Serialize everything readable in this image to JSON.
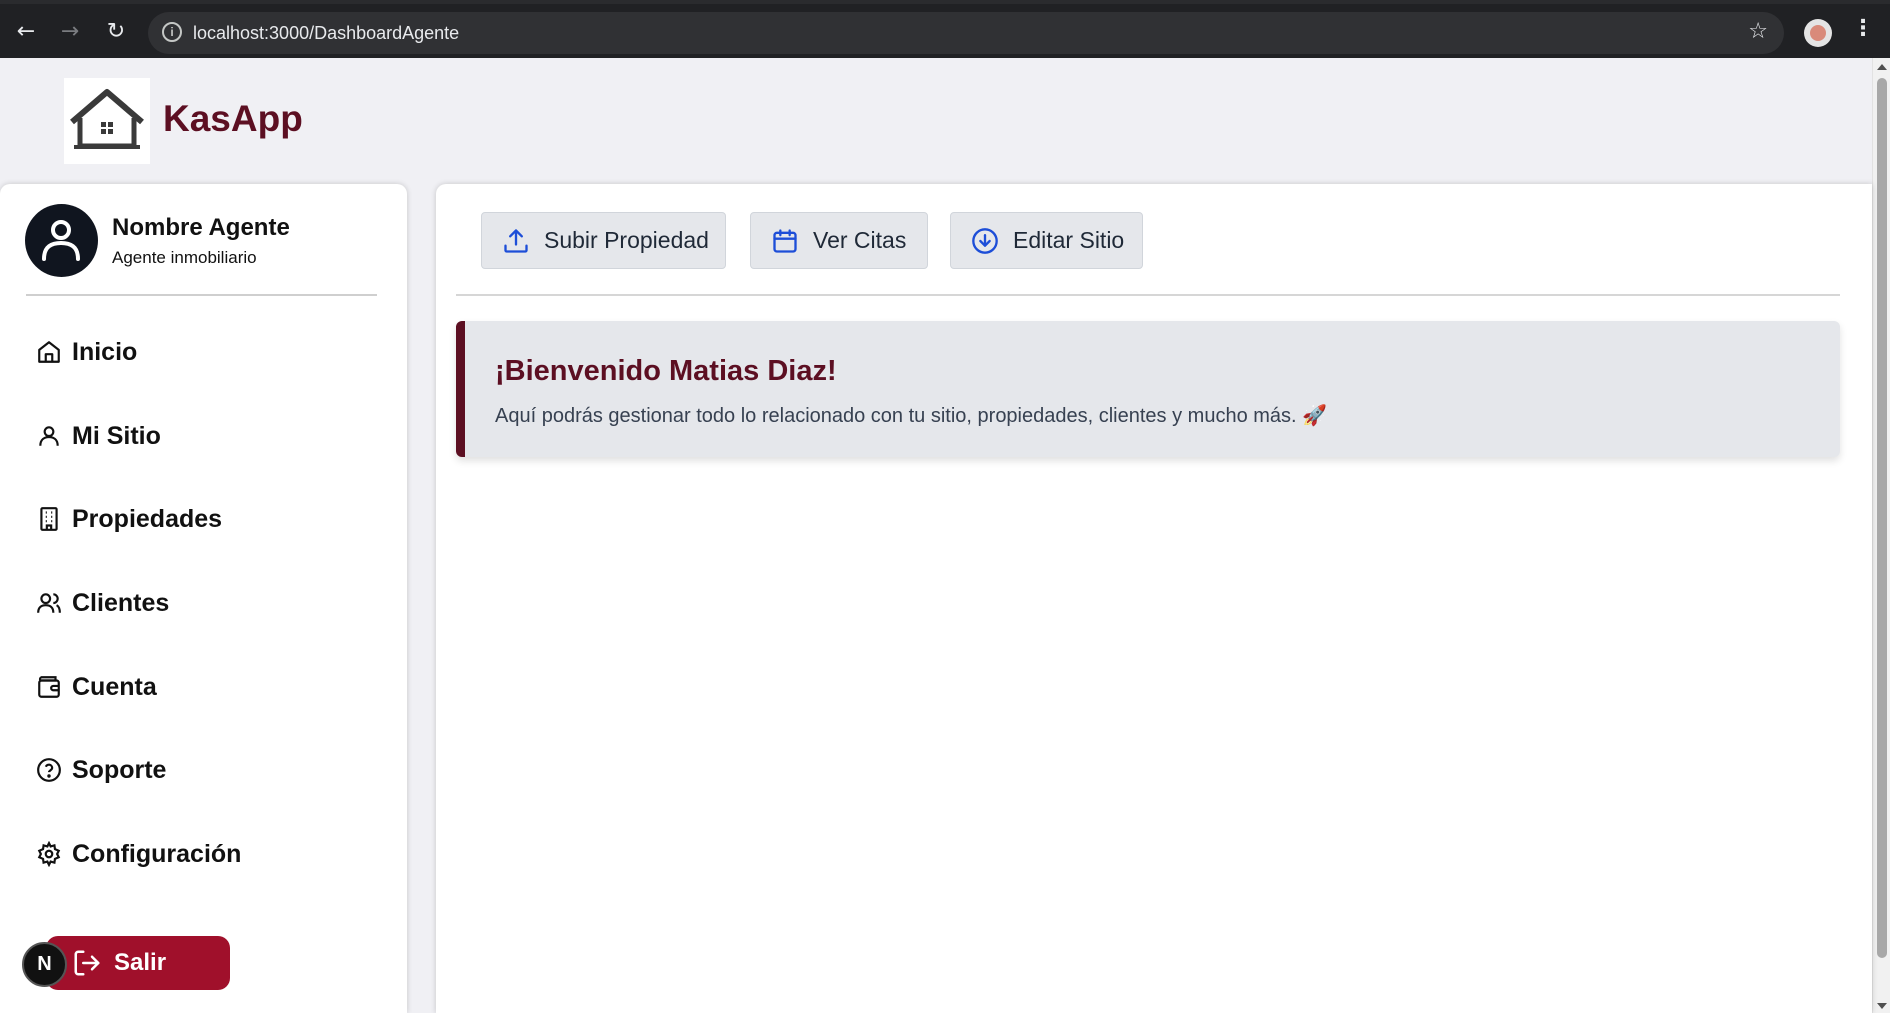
{
  "browser": {
    "url": "localhost:3000/DashboardAgente",
    "back_icon": "←",
    "forward_icon": "→",
    "reload_icon": "↻",
    "star_icon": "☆",
    "menu_icon": "⋮"
  },
  "app": {
    "brand": "KasApp",
    "brand_color": "#5c0f22"
  },
  "agent": {
    "name": "Nombre Agente",
    "role": "Agente inmobiliario"
  },
  "sidebar": {
    "items": [
      {
        "label": "Inicio",
        "icon": "home-icon"
      },
      {
        "label": "Mi Sitio",
        "icon": "user-icon"
      },
      {
        "label": "Propiedades",
        "icon": "building-icon"
      },
      {
        "label": "Clientes",
        "icon": "users-icon"
      },
      {
        "label": "Cuenta",
        "icon": "wallet-icon"
      },
      {
        "label": "Soporte",
        "icon": "help-circle-icon"
      },
      {
        "label": "Configuración",
        "icon": "gear-icon"
      }
    ],
    "logout_label": "Salir",
    "logout_color": "#a0102b"
  },
  "badge": {
    "letter": "N"
  },
  "actions": {
    "upload_label": "Subir Propiedad",
    "appointments_label": "Ver Citas",
    "edit_label": "Editar Sitio",
    "icon_color": "#1d4ed8"
  },
  "welcome": {
    "title": "¡Bienvenido Matias Diaz!",
    "text": "Aquí podrás gestionar todo lo relacionado con tu sitio, propiedades, clientes y mucho más. 🚀"
  }
}
